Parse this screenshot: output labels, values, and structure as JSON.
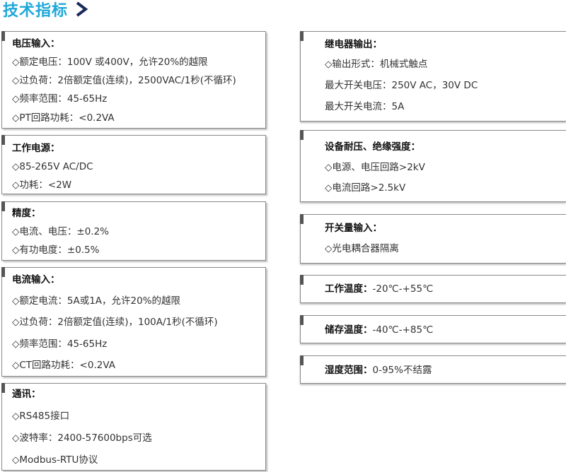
{
  "page_title": "技术指标",
  "left_sections": [
    {
      "heading": "电压输入：",
      "items": [
        "◇额定电压：100V 或400V，允许20%的越限",
        "◇过负荷：2倍额定值(连续)，2500VAC/1秒(不循环)",
        "◇频率范围：45-65Hz",
        "◇PT回路功耗：<0.2VA"
      ]
    },
    {
      "heading": "工作电源：",
      "items": [
        "◇85-265V AC/DC",
        "◇功耗：<2W"
      ]
    },
    {
      "heading": "精度：",
      "items": [
        "◇电流、电压：±0.2%",
        "◇有功电度：±0.5%"
      ]
    },
    {
      "heading": "电流输入：",
      "items": [
        "◇额定电流：5A或1A，允许20%的越限",
        "◇过负荷：2倍额定值(连续)，100A/1秒(不循环)",
        "◇频率范围：45-65Hz",
        "◇CT回路功耗：<0.2VA"
      ]
    },
    {
      "heading": "通讯：",
      "items": [
        "◇RS485接口",
        "◇波特率：2400-57600bps可选",
        "◇Modbus-RTU协议"
      ]
    }
  ],
  "right_sections": [
    {
      "heading": "继电器输出：",
      "items": [
        "◇输出形式：机械式触点",
        "最大开关电压：250V AC，30V DC",
        "最大开关电流：5A"
      ]
    },
    {
      "heading": "设备耐压、绝缘强度：",
      "items": [
        "◇电源、电压回路>2kV",
        "◇电流回路>2.5kV"
      ]
    },
    {
      "heading": "开关量输入：",
      "items": [
        "◇光电耦合器隔离"
      ]
    },
    {
      "heading": "工作温度：",
      "value": "-20℃-+55℃"
    },
    {
      "heading": "储存温度：",
      "value": "-40℃-+85℃"
    },
    {
      "heading": "湿度范围：",
      "value": "0-95%不结露"
    }
  ],
  "colors": {
    "title": "#1fa8d8",
    "arrow": "#1a2a5a",
    "border": "#8a8a8a",
    "text": "#333333"
  },
  "icons": {
    "title_arrow": "chevron-right-icon"
  }
}
